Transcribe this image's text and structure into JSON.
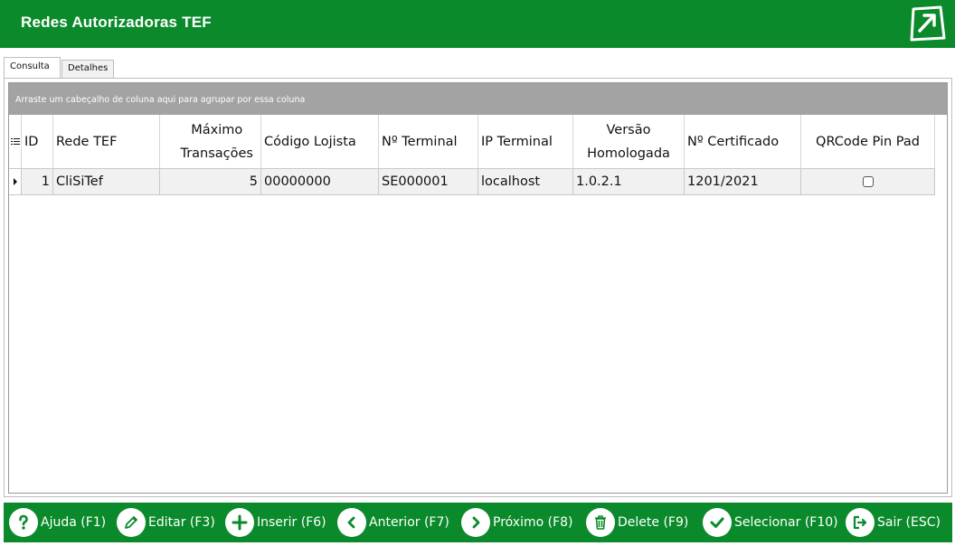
{
  "window": {
    "title": "Redes Autorizadoras TEF",
    "logo_icon": "exit-arrow-logo-icon"
  },
  "tabs": [
    {
      "label": "Consulta",
      "active": true
    },
    {
      "label": "Detalhes",
      "active": false
    }
  ],
  "grid": {
    "group_hint": "Arraste um cabeçalho de coluna aqui para agrupar por essa coluna",
    "columns": [
      {
        "line1": "ID",
        "line2": ""
      },
      {
        "line1": "Rede TEF",
        "line2": ""
      },
      {
        "line1": "Máximo",
        "line2": "Transações"
      },
      {
        "line1": "Código Lojista",
        "line2": ""
      },
      {
        "line1": "Nº Terminal",
        "line2": ""
      },
      {
        "line1": "IP Terminal",
        "line2": ""
      },
      {
        "line1": "Versão",
        "line2": "Homologada"
      },
      {
        "line1": "Nº Certificado",
        "line2": ""
      },
      {
        "line1": "QRCode Pin Pad",
        "line2": ""
      }
    ],
    "rows": [
      {
        "id": "1",
        "rede": "CliSiTef",
        "max": "5",
        "codigo": "00000000",
        "terminal": "SE000001",
        "ip": "localhost",
        "versao": "1.0.2.1",
        "certificado": "1201/2021",
        "qrcode": false
      }
    ]
  },
  "toolbar": {
    "buttons": [
      {
        "label": "Ajuda (F1)",
        "icon": "question-icon"
      },
      {
        "label": "Editar (F3)",
        "icon": "pencil-icon"
      },
      {
        "label": "Inserir (F6)",
        "icon": "plus-icon"
      },
      {
        "label": "Anterior (F7)",
        "icon": "chevron-left-icon"
      },
      {
        "label": "Próximo (F8)",
        "icon": "chevron-right-icon"
      },
      {
        "label": "Delete (F9)",
        "icon": "trash-icon"
      },
      {
        "label": "Selecionar (F10)",
        "icon": "check-icon"
      },
      {
        "label": "Sair (ESC)",
        "icon": "exit-icon"
      }
    ]
  },
  "colors": {
    "brand_green": "#0b8a2b",
    "group_bar": "#a3a3a3",
    "row_bg": "#f1f1f1"
  }
}
